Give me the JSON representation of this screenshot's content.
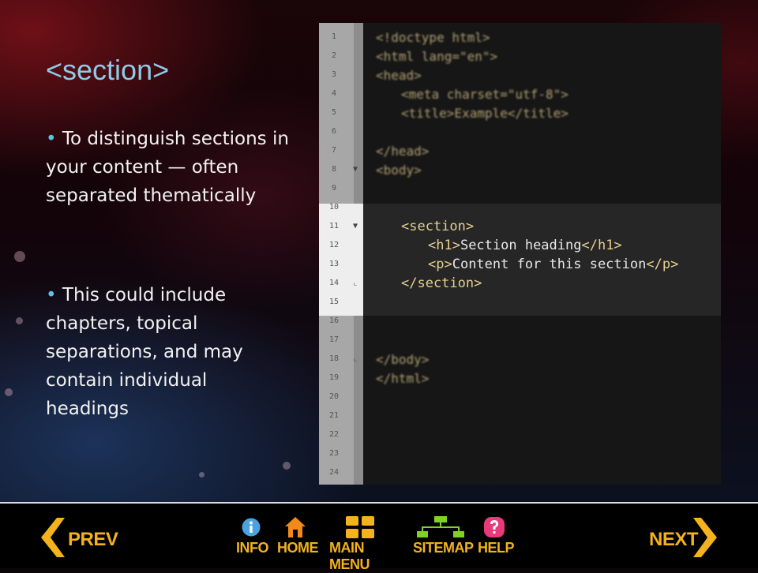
{
  "slide": {
    "title": "<section>",
    "bullets": [
      "To distinguish sections in your content — often separated thematically",
      "This could include chapters, topical separations, and may contain individual headings"
    ]
  },
  "editor": {
    "line_numbers": [
      "1",
      "2",
      "3",
      "4",
      "5",
      "6",
      "7",
      "8",
      "9",
      "10",
      "11",
      "12",
      "13",
      "14",
      "15",
      "16",
      "17",
      "18",
      "19",
      "20",
      "21",
      "22",
      "23",
      "24"
    ],
    "lines": {
      "l1": "<!doctype html>",
      "l2": "<html lang=\"en\">",
      "l3": "<head>",
      "l4": "<meta charset=\"utf-8\">",
      "l5": "<title>Example</title>",
      "l7": "</head>",
      "l8": "<body>",
      "l11_open": "<section>",
      "l12_tag1": "<h1>",
      "l12_text": "Section heading",
      "l12_tag2": "</h1>",
      "l13_tag1": "<p>",
      "l13_text": "Content for this section",
      "l13_tag2": "</p>",
      "l14_close": "</section>",
      "l18": "</body>",
      "l19": "</html>"
    }
  },
  "nav": {
    "prev": "PREV",
    "info": "INFO",
    "home": "HOME",
    "main_menu": "MAIN MENU",
    "sitemap": "SITEMAP",
    "help": "HELP",
    "next": "NEXT"
  },
  "colors": {
    "nav_label": "#f4b21c",
    "info_icon": "#4aa3e0",
    "home_icon": "#f08a1c",
    "main_menu_icon": "#f4b21c",
    "sitemap_icon": "#7fd321",
    "help_icon": "#e83a7a"
  }
}
